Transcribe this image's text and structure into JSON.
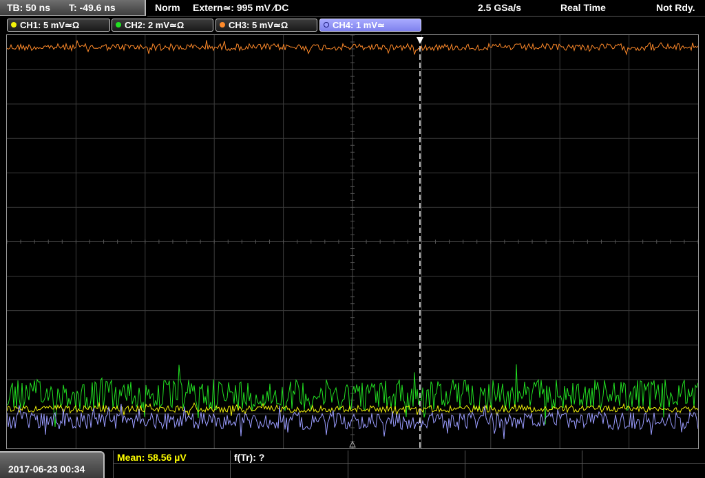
{
  "header": {
    "timebase": "TB: 50 ns",
    "trigger_time": "T: -49.6 ns",
    "acq_mode": "Norm",
    "trigger_source": "Extern≃: 995 mV ∕DC",
    "sample_rate": "2.5 GSa/s",
    "time_mode": "Real Time",
    "status": "Not Rdy."
  },
  "channels": [
    {
      "label": "CH1: 5 mV≃Ω",
      "color": "#f2f20a",
      "active": false
    },
    {
      "label": "CH2: 2 mV≃Ω",
      "color": "#22e022",
      "active": false
    },
    {
      "label": "CH3: 5 mV≃Ω",
      "color": "#ff8a2a",
      "active": false
    },
    {
      "label": "CH4: 1 mV≃",
      "color": "#9a9cff",
      "active": true
    }
  ],
  "chart_data": {
    "type": "line",
    "grid": "10 x 12 divisions",
    "series": [
      {
        "channel": "CH3",
        "color": "#ff8a2a",
        "baseline_div": 0.35,
        "noise_div": 0.1
      },
      {
        "channel": "CH2",
        "color": "#22e022",
        "baseline_div": 10.45,
        "noise_div": 0.45
      },
      {
        "channel": "CH1",
        "color": "#f2f20a",
        "baseline_div": 10.85,
        "noise_div": 0.1
      },
      {
        "channel": "CH4",
        "color": "#9a9cff",
        "baseline_div": 11.2,
        "noise_div": 0.25
      }
    ],
    "trigger_marker_div": 12.0
  },
  "footer": {
    "date": "2017-06-23 00:34",
    "measurement": "Mean: 58.56 µV",
    "measurement_color": "#ffff00",
    "fft": "f(Tr): ?"
  }
}
